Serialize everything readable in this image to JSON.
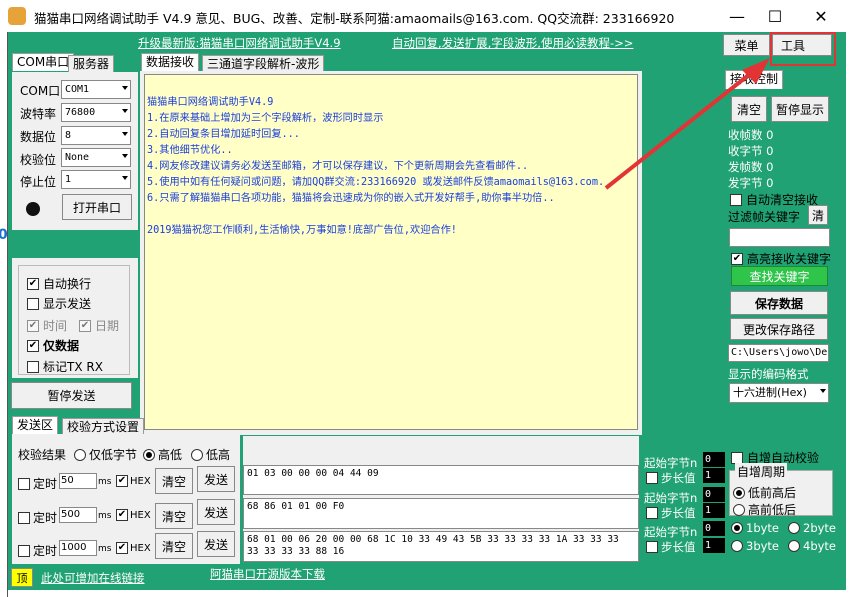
{
  "window": {
    "title": "猫猫串口网络调试助手 V4.9 意见、BUG、改善、定制-联系阿猫:amaomails@163.com. QQ交流群: 233166920",
    "minimize": "—",
    "maximize": "☐",
    "close": "✕"
  },
  "top_links": {
    "upgrade": "升级最新版:猫猫串口网络调试助手V4.9",
    "help": "自动回复,发送扩展,字段波形,使用必读教程->>"
  },
  "menu": {
    "menu_label": "菜单",
    "tools_label": "工具"
  },
  "left_tabs": [
    "COM串口",
    "服务器"
  ],
  "serial": {
    "fields": [
      {
        "label": "COM口",
        "value": "COM1"
      },
      {
        "label": "波特率",
        "value": "76800"
      },
      {
        "label": "数据位",
        "value": "8"
      },
      {
        "label": "校验位",
        "value": "None"
      },
      {
        "label": "停止位",
        "value": "1"
      }
    ],
    "open_button": "打开串口"
  },
  "options": {
    "auto_newline": "自动换行",
    "show_send": "显示发送",
    "time": "时间",
    "date": "日期",
    "data_only": "仅数据",
    "mark_tx_rx": "标记TX RX",
    "pause_send": "暂停发送"
  },
  "center_tabs": [
    "数据接收",
    "三通道字段解析-波形"
  ],
  "receive_lines": [
    "猫猫串口网络调试助手V4.9",
    "1.在原来基础上增加为三个字段解析，波形同时显示",
    "2.自动回复条目增加延时回复...",
    "3.其他细节优化..",
    "4.网友修改建议请务必发送至邮箱，才可以保存建议，下个更新周期会先查看邮件..",
    "5.使用中如有任何疑问或问题，请加QQ群交流:233166920 或发送邮件反馈amaomails@163.com.",
    "6.只需了解猫猫串口各项功能，猫猫将会迅速成为你的嵌入式开发好帮手,助你事半功倍..",
    "",
    "2019猫猫祝您工作顺利,生活愉快,万事如意!底部广告位,欢迎合作!"
  ],
  "right_panel": {
    "tab": "接收控制",
    "clear": "清空",
    "pause_display": "暂停显示",
    "stats": [
      "收帧数 0",
      "收字节 0",
      "发帧数 0",
      "发字节 0"
    ],
    "auto_clear": "自动清空接收",
    "filter_label": "过滤帧关键字",
    "filter_clear": "清",
    "highlight": "高亮接收关键字",
    "find_keyword": "查找关键字",
    "save_data": "保存数据",
    "change_path": "更改保存路径",
    "save_path": "C:\\Users\\jowo\\De",
    "display_encoding": "显示的编码格式",
    "encoding": "十六进制(Hex)"
  },
  "send_tabs": [
    "发送区",
    "校验方式设置"
  ],
  "send_area": {
    "check_result": "校验结果",
    "only_bytes": "仅低字节",
    "high_low": "高低",
    "low_high": "低高",
    "rows": [
      {
        "timer_label": "定时",
        "interval": "50",
        "unit": "ms",
        "hex": "HEX",
        "clear": "清空",
        "send": "发送",
        "data": "01 03 00 00 00 04 44 09"
      },
      {
        "timer_label": "定时",
        "interval": "500",
        "unit": "ms",
        "hex": "HEX",
        "clear": "清空",
        "send": "发送",
        "data": "68 86 01 01 00 F0"
      },
      {
        "timer_label": "定时",
        "interval": "1000",
        "unit": "ms",
        "hex": "HEX",
        "clear": "清空",
        "send": "发送",
        "data": "68 01 00 06 20 00 00 68 1C 10 33 49 43 5B 33 33 33 33 1A 33 33 33\n33 33 33 33 88 16"
      }
    ]
  },
  "checksum": {
    "start_label": "起始字节n",
    "step_label": "步长值",
    "rows": [
      {
        "start": "0",
        "step": "1"
      },
      {
        "start": "0",
        "step": "1"
      },
      {
        "start": "0",
        "step": "1"
      }
    ],
    "auto_increment": "自增自动校验",
    "period_label": "自增周期",
    "low_first": "低前高后",
    "high_first": "高前低后",
    "bytes": [
      "1byte",
      "2byte",
      "3byte",
      "4byte"
    ]
  },
  "bottom": {
    "top_button": "顶",
    "add_link": "此处可增加在线链接",
    "open_source": "阿猫串口开源版本下载"
  },
  "colors": {
    "panel": "#21a274",
    "receive_bg": "#ffffc6",
    "receive_text": "#1a3ee0",
    "highlight": "#e23434"
  }
}
